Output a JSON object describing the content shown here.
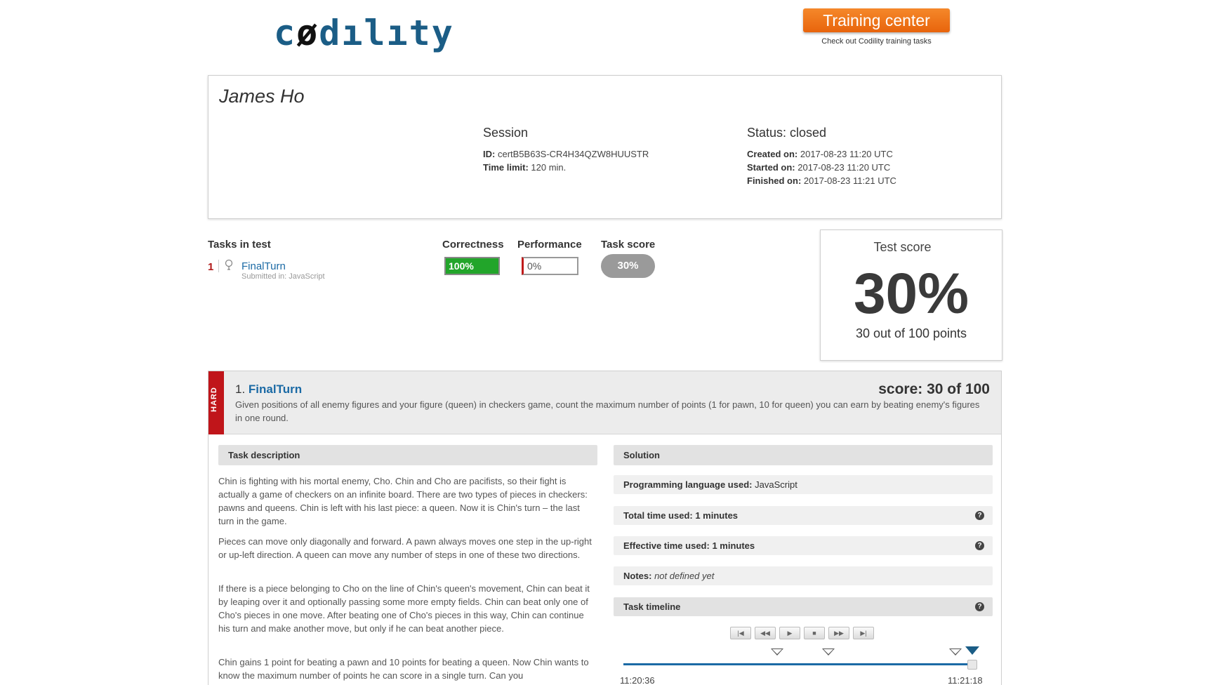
{
  "header": {
    "logo_text": "codility",
    "training_button": "Training center",
    "training_sub": "Check out Codility training tasks"
  },
  "candidate": {
    "name": "James Ho",
    "session": {
      "title": "Session",
      "id_label": "ID:",
      "id_value": "certB5B63S-CR4H34QZW8HUUSTR",
      "time_limit_label": "Time limit:",
      "time_limit_value": "120 min."
    },
    "status": {
      "title": "Status: closed",
      "created_label": "Created on:",
      "created_value": "2017-08-23 11:20 UTC",
      "started_label": "Started on:",
      "started_value": "2017-08-23 11:20 UTC",
      "finished_label": "Finished on:",
      "finished_value": "2017-08-23 11:21 UTC"
    }
  },
  "tasks_table": {
    "headers": {
      "tasks": "Tasks in test",
      "correctness": "Correctness",
      "performance": "Performance",
      "task_score": "Task score"
    },
    "rows": [
      {
        "number": "1",
        "name": "FinalTurn",
        "submitted": "Submitted in: JavaScript",
        "correctness": "100%",
        "performance": "0%",
        "task_score": "30%"
      }
    ]
  },
  "test_score": {
    "title": "Test score",
    "value": "30%",
    "sub": "30 out of 100 points"
  },
  "task_detail": {
    "difficulty": "HARD",
    "number": "1.",
    "name": "FinalTurn",
    "score": "score: 30 of 100",
    "summary": "Given positions of all enemy figures and your figure (queen) in checkers game, count the maximum number of points (1 for pawn, 10 for queen) you can earn by beating enemy's figures in one round.",
    "description_title": "Task description",
    "paragraphs": [
      "Chin is fighting with his mortal enemy, Cho. Chin and Cho are pacifists, so their fight is actually a game of checkers on an infinite board. There are two types of pieces in checkers: pawns and queens. Chin is left with his last piece: a queen. Now it is Chin's turn – the last turn in the game.",
      "Pieces can move only diagonally and forward. A pawn always moves one step in the up-right or up-left direction. A queen can move any number of steps in one of these two directions.",
      "If there is a piece belonging to Cho on the line of Chin's queen's movement, Chin can beat it by leaping over it and optionally passing some more empty fields. Chin can beat only one of Cho's pieces in one move. After beating one of Cho's pieces in this way, Chin can continue his turn and make another move, but only if he can beat another piece.",
      "Chin gains 1 point for beating a pawn and 10 points for beating a queen. Now Chin wants to know the maximum number of points he can score in a single turn. Can you"
    ],
    "solution": {
      "title": "Solution",
      "language_label": "Programming language used:",
      "language_value": "JavaScript",
      "total_time_label": "Total time used:",
      "total_time_value": "1 minutes",
      "effective_time_label": "Effective time used:",
      "effective_time_value": "1 minutes",
      "notes_label": "Notes:",
      "notes_value": "not defined yet",
      "timeline_title": "Task timeline",
      "timeline_start": "11:20:36",
      "timeline_end": "11:21:18",
      "help_glyph": "?"
    },
    "controls": [
      "|◀",
      "◀◀",
      "▶",
      "■",
      "▶▶",
      "▶|"
    ]
  }
}
